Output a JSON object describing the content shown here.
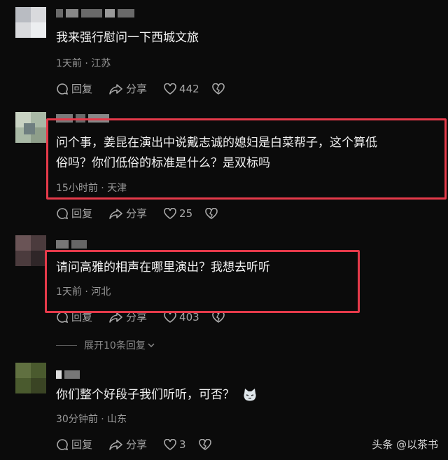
{
  "comments": [
    {
      "text_lines": [
        "我来强行慰问一下西城文旅"
      ],
      "meta": "1天前 · 江苏",
      "reply_label": "回复",
      "share_label": "分享",
      "likes": "442"
    },
    {
      "text_lines": [
        "问个事，姜昆在演出中说戴志诚的媳妇是白菜帮子，这个算低",
        "俗吗？你们低俗的标准是什么？是双标吗"
      ],
      "meta": "15小时前 · 天津",
      "reply_label": "回复",
      "share_label": "分享",
      "likes": "25"
    },
    {
      "text_lines": [
        "请问高雅的相声在哪里演出？我想去听听"
      ],
      "meta": "1天前 · 河北",
      "reply_label": "回复",
      "share_label": "分享",
      "likes": "403",
      "expand_label": "展开10条回复"
    },
    {
      "text_lines": [
        "你们整个好段子我们听听，可否？"
      ],
      "meta": "30分钟前 · 山东",
      "reply_label": "回复",
      "share_label": "分享",
      "likes": "3"
    }
  ],
  "watermark": "头条 @以茶书",
  "colors": {
    "highlight_box": "#e53a4a",
    "background": "#0b0b0b"
  },
  "icons": [
    "comment-icon",
    "share-icon",
    "heart-icon",
    "broken-heart-icon",
    "chevron-down-icon",
    "cat-emoji-icon"
  ]
}
